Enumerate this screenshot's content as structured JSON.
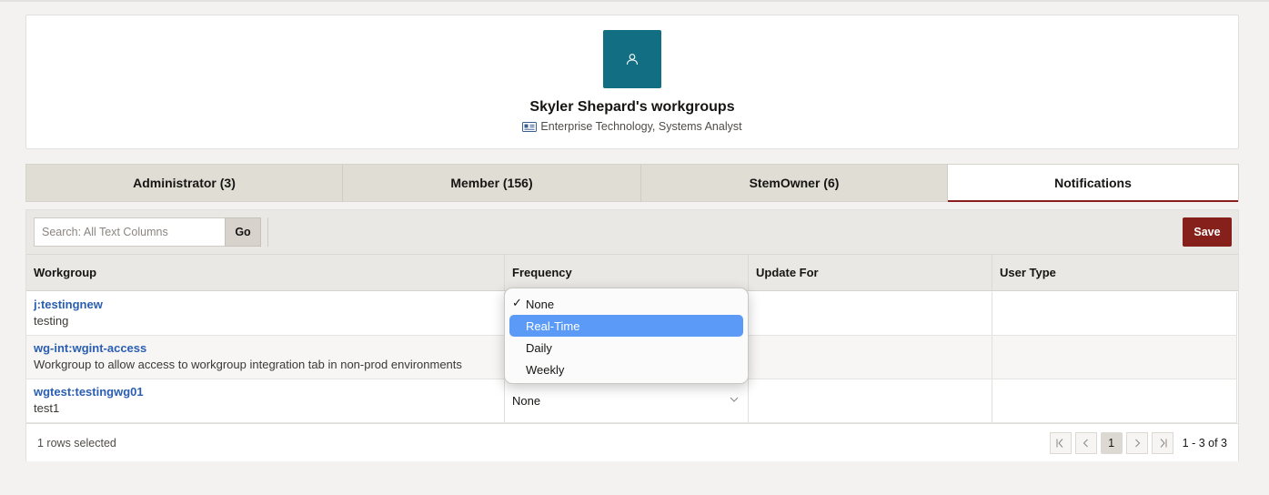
{
  "profile": {
    "title": "Skyler Shepard's workgroups",
    "subtitle": "Enterprise Technology, Systems Analyst",
    "avatar_color": "#126f83"
  },
  "tabs": [
    {
      "label": "Administrator (3)"
    },
    {
      "label": "Member (156)"
    },
    {
      "label": "StemOwner (6)"
    },
    {
      "label": "Notifications",
      "active": true
    }
  ],
  "toolbar": {
    "search_placeholder": "Search: All Text Columns",
    "go_label": "Go",
    "save_label": "Save",
    "save_color": "#85201a"
  },
  "columns": [
    "Workgroup",
    "Frequency",
    "Update For",
    "User Type"
  ],
  "rows": [
    {
      "name": "j:testingnew",
      "desc": "testing",
      "frequency": "None",
      "update_for": "",
      "user_type": ""
    },
    {
      "name": "wg-int:wgint-access",
      "desc": "Workgroup to allow access to workgroup integration tab in non-prod environments",
      "frequency": "None",
      "update_for": "",
      "user_type": ""
    },
    {
      "name": "wgtest:testingwg01",
      "desc": "test1",
      "frequency": "None",
      "update_for": "",
      "user_type": ""
    }
  ],
  "dropdown": {
    "check_glyph": "✓",
    "options": [
      "None",
      "Real-Time",
      "Daily",
      "Weekly"
    ],
    "selected": "None",
    "highlighted": "Real-Time",
    "highlight_color": "#5b9bf7"
  },
  "footer": {
    "rows_selected": "1 rows selected",
    "current_page": "1",
    "range": "1 - 3 of 3"
  },
  "link_color": "#2a5eb0"
}
